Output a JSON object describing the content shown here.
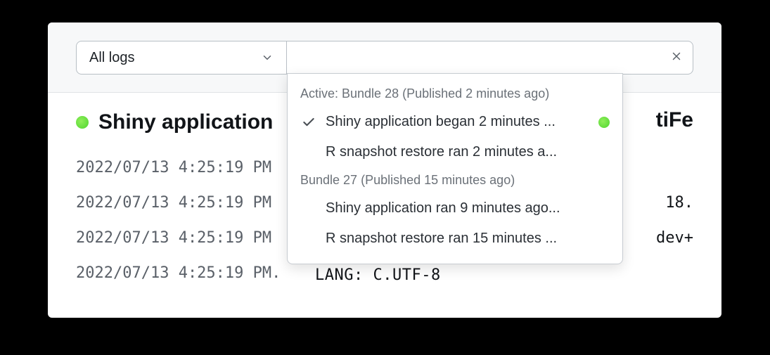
{
  "topbar": {
    "filter_label": "All logs",
    "search_value": "",
    "search_placeholder": ""
  },
  "heading": {
    "status": "running",
    "title_left": "Shiny application",
    "title_right": "tiFe"
  },
  "log_lines": [
    {
      "ts": "2022/07/13 4:25:19 PM",
      "right": ""
    },
    {
      "ts": "2022/07/13 4:25:19 PM",
      "right": "18."
    },
    {
      "ts": "2022/07/13 4:25:19 PM",
      "right": "dev+"
    },
    {
      "ts": "2022/07/13 4:25:19 PM.",
      "right": ""
    }
  ],
  "lang_fragment": "LANG: C.UTF-8",
  "dropdown": {
    "groups": [
      {
        "header": "Active: Bundle 28 (Published 2 minutes ago)",
        "items": [
          {
            "label": "Shiny application began 2 minutes ...",
            "selected": true,
            "running": true
          },
          {
            "label": "R snapshot restore ran 2 minutes a...",
            "selected": false,
            "running": false
          }
        ]
      },
      {
        "header": "Bundle 27 (Published 15 minutes ago)",
        "items": [
          {
            "label": "Shiny application ran 9 minutes ago...",
            "selected": false,
            "running": false
          },
          {
            "label": "R snapshot restore ran 15 minutes ...",
            "selected": false,
            "running": false
          }
        ]
      }
    ]
  }
}
